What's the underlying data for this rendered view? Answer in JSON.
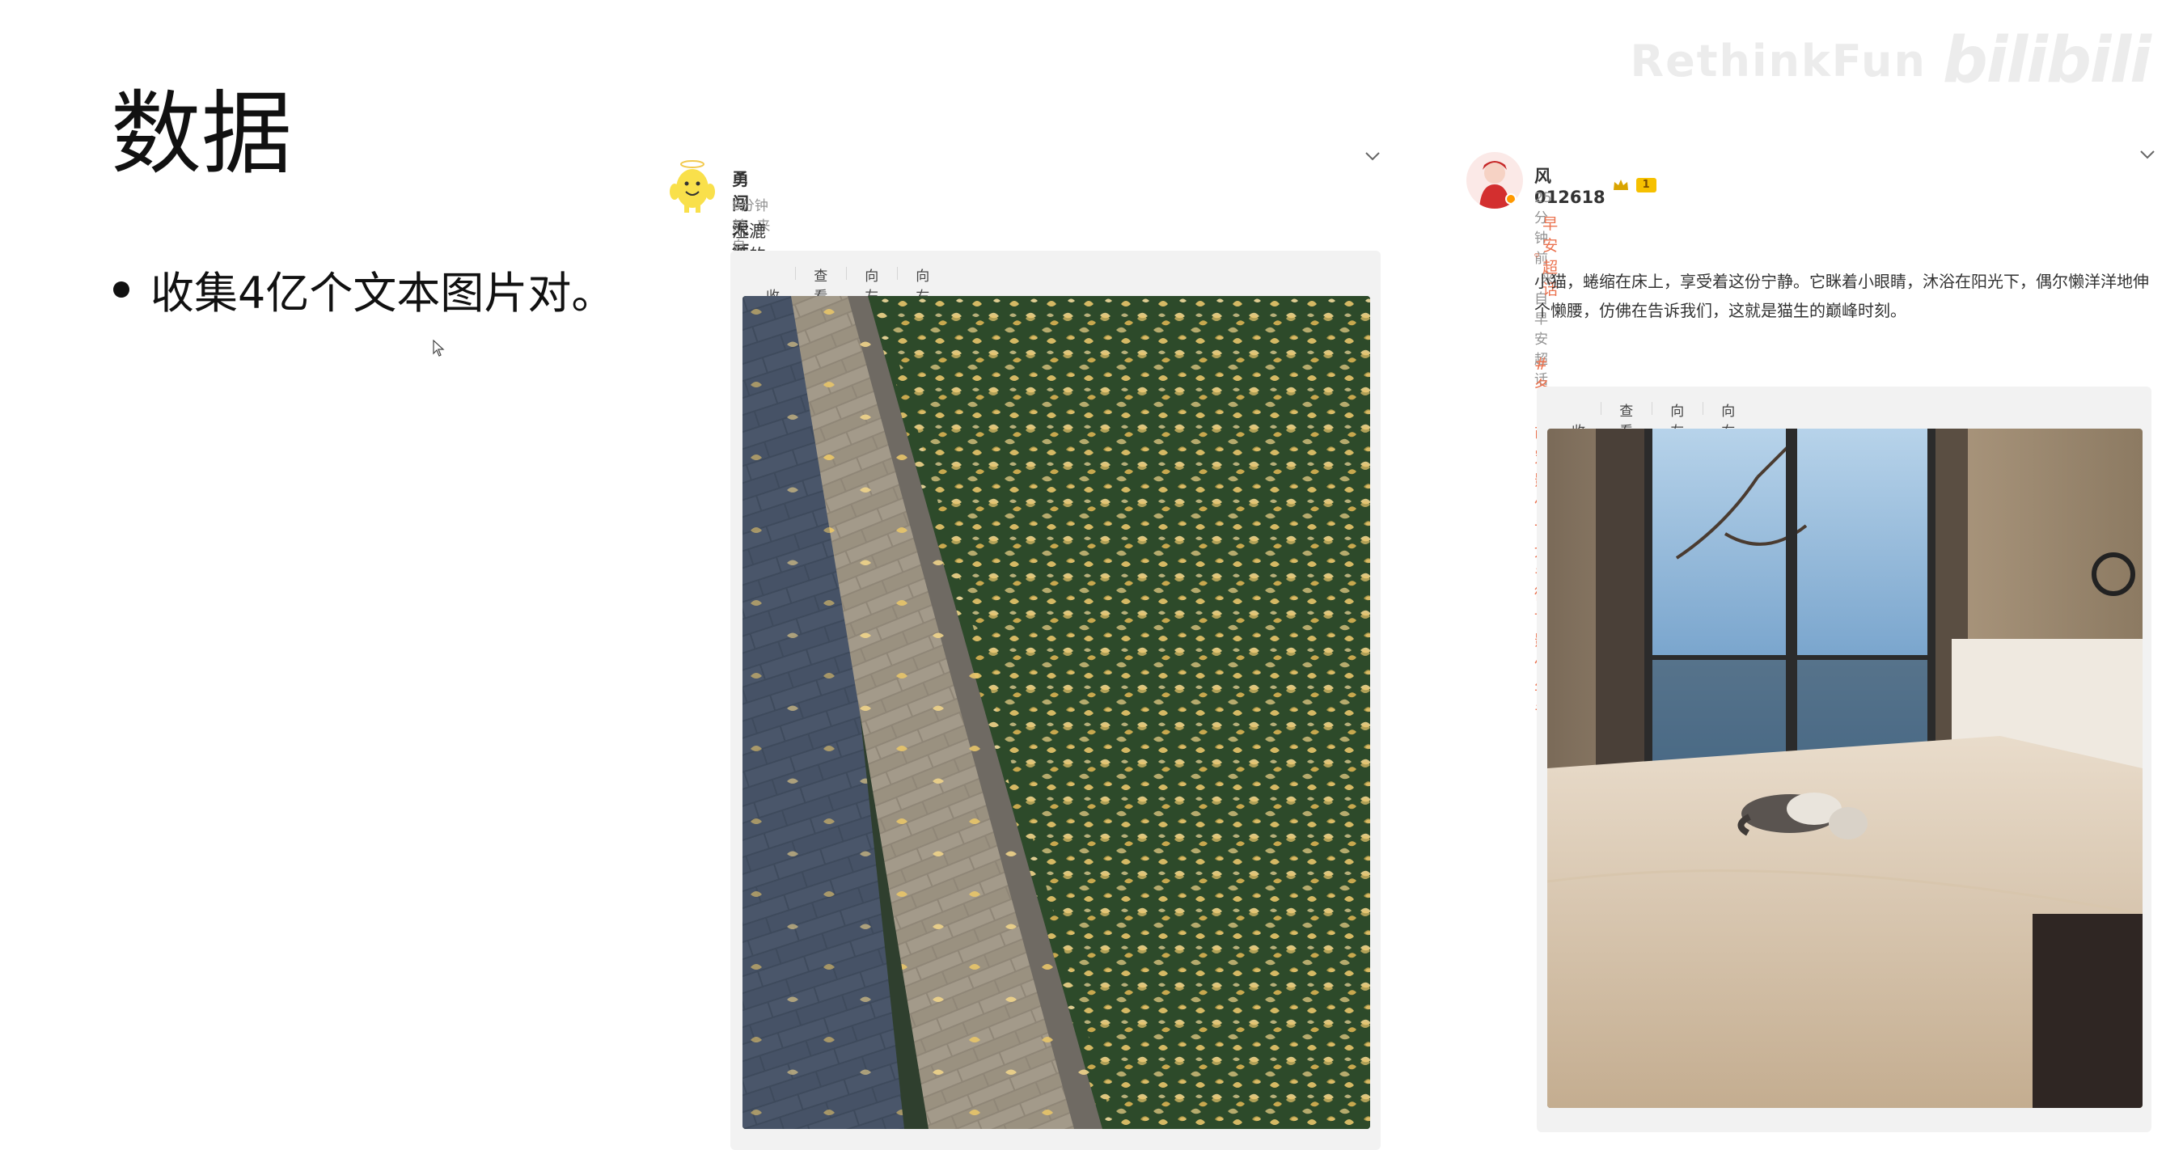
{
  "slide": {
    "title": "数据",
    "bullet": "收集4亿个文本图片对。"
  },
  "watermark": {
    "text": "RethinkFun",
    "logo": "bilibili"
  },
  "posts": [
    {
      "username": "勇闯天涯月女士",
      "time": "8分钟前",
      "source": "来自 iPhone客户端",
      "text": "湿漉漉的银杏洒满草坪，宣告着秋天的结束",
      "toolbar": [
        "收起",
        "查看大图",
        "向左旋转",
        "向右旋转"
      ],
      "icons": [
        "collapse-icon",
        "magnifier-icon",
        "rotate-left-icon",
        "rotate-right-icon"
      ]
    },
    {
      "username": "风012618",
      "badge": "1",
      "time": "25分钟前",
      "source": "来自 早安超话",
      "super_topic": "早安超话",
      "text": "小猫，蜷缩在床上，享受着这份宁静。它眯着小眼睛，沐浴在阳光下，偶尔懒洋洋地伸个懒腰，仿佛在告诉我们，这就是猫生的巅峰时刻。",
      "tags": "#冬日萌宠影像计划##微博影像年#",
      "toolbar": [
        "收起",
        "查看大图",
        "向左旋转",
        "向右旋转"
      ],
      "icons": [
        "collapse-icon",
        "magnifier-icon",
        "rotate-left-icon",
        "rotate-right-icon"
      ]
    }
  ],
  "colors": {
    "accent": "#eb7350",
    "meta": "#939393",
    "toolbox_bg": "#f2f2f2"
  }
}
